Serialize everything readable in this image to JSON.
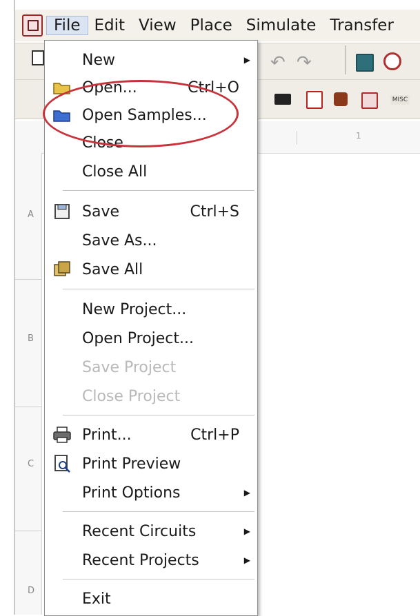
{
  "menubar": {
    "items": [
      "File",
      "Edit",
      "View",
      "Place",
      "Simulate",
      "Transfer"
    ],
    "active": "File"
  },
  "file_menu": {
    "items": [
      {
        "label": "New",
        "shortcut": "",
        "submenu": true,
        "enabled": true
      },
      {
        "label": "Open...",
        "shortcut": "Ctrl+O",
        "submenu": false,
        "enabled": true,
        "icon": "open-folder-icon"
      },
      {
        "label": "Open Samples...",
        "shortcut": "",
        "submenu": false,
        "enabled": true,
        "icon": "open-samples-icon"
      },
      {
        "label": "Close",
        "shortcut": "",
        "submenu": false,
        "enabled": true
      },
      {
        "label": "Close All",
        "shortcut": "",
        "submenu": false,
        "enabled": true
      },
      {
        "label": "Save",
        "shortcut": "Ctrl+S",
        "submenu": false,
        "enabled": true,
        "icon": "save-icon"
      },
      {
        "label": "Save As...",
        "shortcut": "",
        "submenu": false,
        "enabled": true
      },
      {
        "label": "Save All",
        "shortcut": "",
        "submenu": false,
        "enabled": true,
        "icon": "save-all-icon"
      },
      {
        "label": "New Project...",
        "shortcut": "",
        "submenu": false,
        "enabled": true
      },
      {
        "label": "Open Project...",
        "shortcut": "",
        "submenu": false,
        "enabled": true
      },
      {
        "label": "Save Project",
        "shortcut": "",
        "submenu": false,
        "enabled": false
      },
      {
        "label": "Close Project",
        "shortcut": "",
        "submenu": false,
        "enabled": false
      },
      {
        "label": "Print...",
        "shortcut": "Ctrl+P",
        "submenu": false,
        "enabled": true,
        "icon": "printer-icon"
      },
      {
        "label": "Print Preview",
        "shortcut": "",
        "submenu": false,
        "enabled": true,
        "icon": "print-preview-icon"
      },
      {
        "label": "Print Options",
        "shortcut": "",
        "submenu": true,
        "enabled": true
      },
      {
        "label": "Recent Circuits",
        "shortcut": "",
        "submenu": true,
        "enabled": true
      },
      {
        "label": "Recent Projects",
        "shortcut": "",
        "submenu": true,
        "enabled": true
      },
      {
        "label": "Exit",
        "shortcut": "",
        "submenu": false,
        "enabled": true
      }
    ]
  },
  "ruler": {
    "rows": [
      "A",
      "B",
      "C",
      "D"
    ],
    "columns": [
      "1"
    ]
  },
  "colors": {
    "highlight_ellipse": "#c8323a",
    "menubar_bg": "#f3f1ea",
    "disabled_text": "#b9b9b9"
  }
}
